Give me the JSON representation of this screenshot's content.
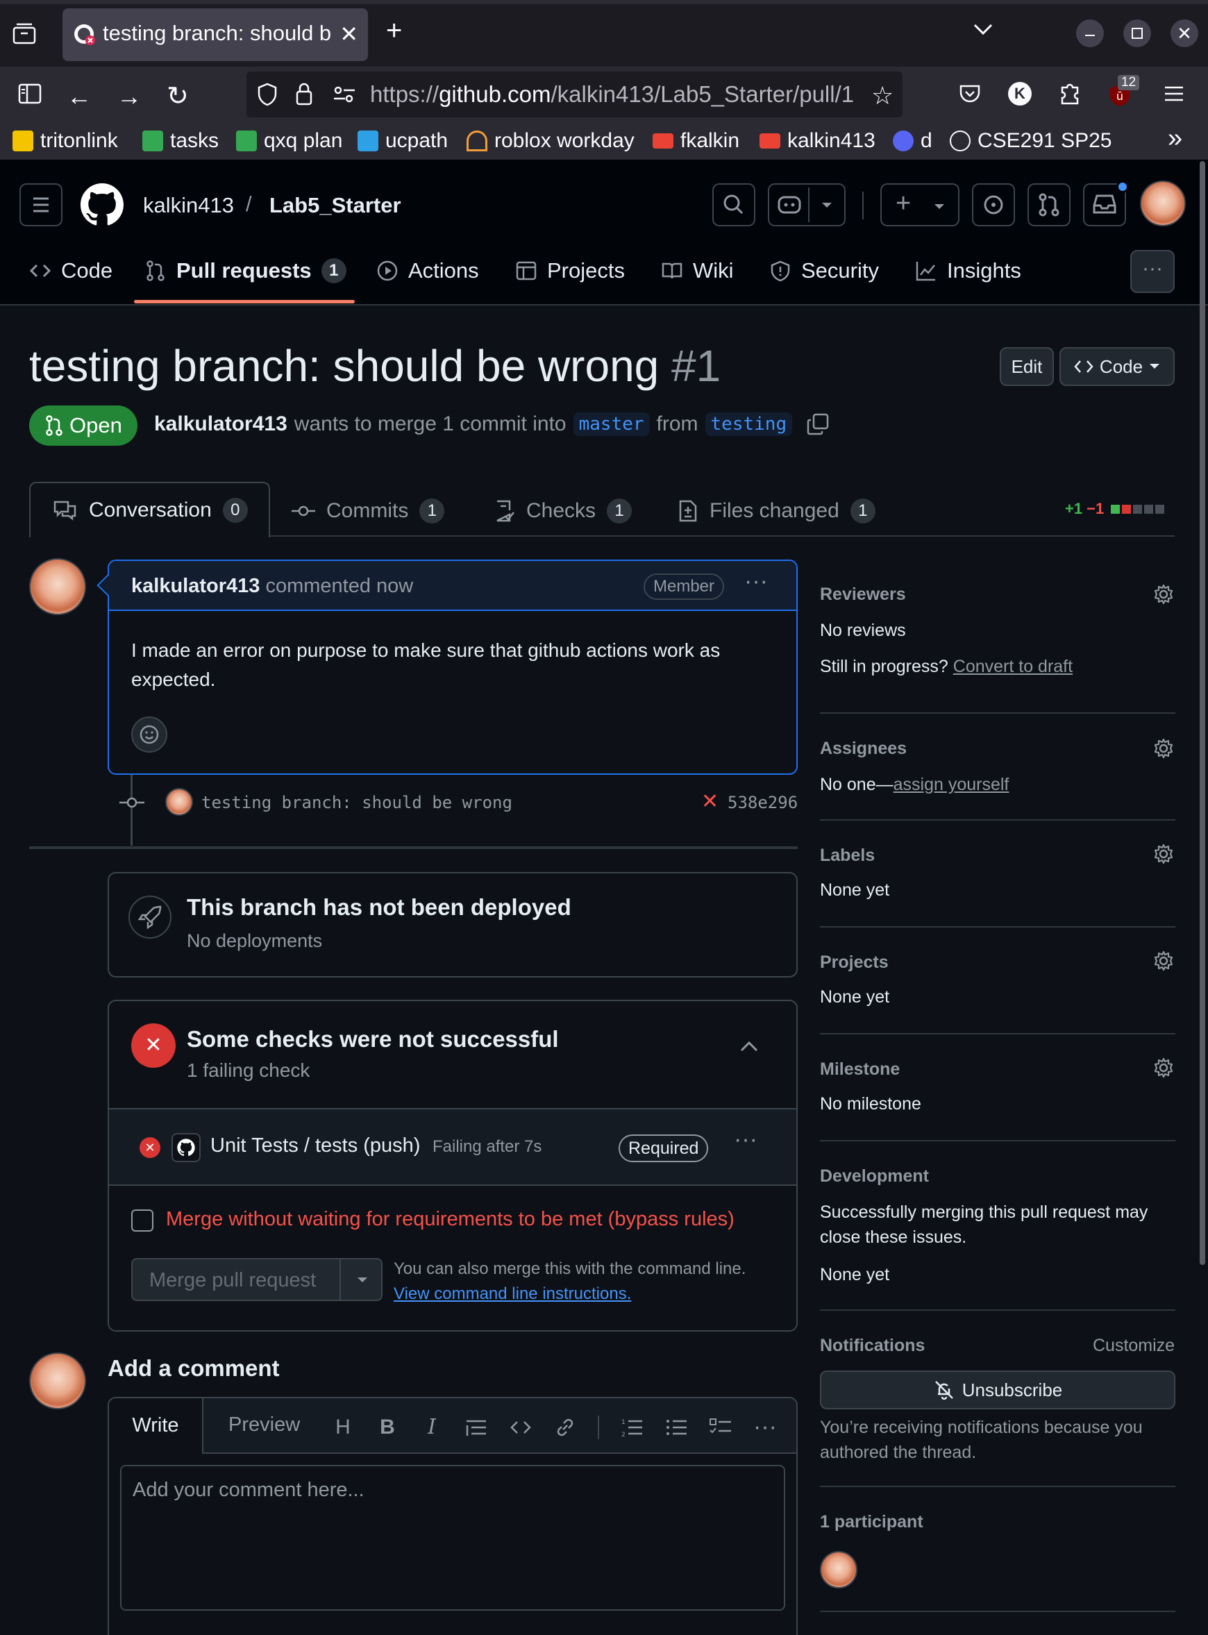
{
  "browser": {
    "tab_title": "testing branch: should be",
    "url_prefix": "https://",
    "url_host": "github.com",
    "url_path": "/kalkin413/Lab5_Starter/pull/1",
    "extension_badge": "12",
    "bookmarks": [
      {
        "label": "tritonlink",
        "color": "#f5c400"
      },
      {
        "label": "tasks",
        "color": "#34a853"
      },
      {
        "label": "qxq plan",
        "color": "#34a853"
      },
      {
        "label": "ucpath",
        "color": "#2ea0e6"
      },
      {
        "label": "roblox workday",
        "color": "#f29d38"
      },
      {
        "label": "fkalkin",
        "color": "#ea4335"
      },
      {
        "label": "kalkin413",
        "color": "#ea4335"
      },
      {
        "label": "d",
        "color": "#5865f2"
      },
      {
        "label": "CSE291 SP25",
        "color": "#cccccc"
      }
    ],
    "overflow_label": "»"
  },
  "header": {
    "owner": "kalkin413",
    "separator": "/",
    "repo": "Lab5_Starter",
    "nav": [
      {
        "label": "Code",
        "icon": "code-icon"
      },
      {
        "label": "Pull requests",
        "icon": "pull-request-icon",
        "count": "1"
      },
      {
        "label": "Actions",
        "icon": "play-icon"
      },
      {
        "label": "Projects",
        "icon": "table-icon"
      },
      {
        "label": "Wiki",
        "icon": "book-icon"
      },
      {
        "label": "Security",
        "icon": "shield-icon"
      },
      {
        "label": "Insights",
        "icon": "graph-icon"
      }
    ],
    "more": "···"
  },
  "pr": {
    "title": "testing branch: should be wrong",
    "number": "#1",
    "edit_label": "Edit",
    "code_label": "Code",
    "state": "Open",
    "author": "kalkulator413",
    "merge_text": "wants to merge 1 commit into",
    "base": "master",
    "from_text": "from",
    "head": "testing",
    "tabs": [
      {
        "label": "Conversation",
        "count": "0"
      },
      {
        "label": "Commits",
        "count": "1"
      },
      {
        "label": "Checks",
        "count": "1"
      },
      {
        "label": "Files changed",
        "count": "1"
      }
    ],
    "diff_add": "+1",
    "diff_del": "−1"
  },
  "comment": {
    "author": "kalkulator413",
    "time": "commented now",
    "role": "Member",
    "menu": "···",
    "body": "I made an error on purpose to make sure that github actions work as expected."
  },
  "commit": {
    "message": "testing branch: should be wrong",
    "sha": "538e296"
  },
  "deploy": {
    "title": "This branch has not been deployed",
    "subtitle": "No deployments"
  },
  "checks": {
    "title": "Some checks were not successful",
    "subtitle": "1 failing check",
    "item_name": "Unit Tests / tests (push)",
    "item_status": "Failing after 7s",
    "required": "Required",
    "menu": "···",
    "bypass": "Merge without waiting for requirements to be met (bypass rules)",
    "merge_button": "Merge pull request",
    "cli_text": "You can also merge this with the command line.",
    "cli_link": "View command line instructions."
  },
  "add_comment": {
    "title": "Add a comment",
    "write_tab": "Write",
    "preview_tab": "Preview",
    "placeholder": "Add your comment here..."
  },
  "sidebar": {
    "reviewers": {
      "heading": "Reviewers",
      "value": "No reviews",
      "progress_prefix": "Still in progress?",
      "progress_link": "Convert to draft"
    },
    "assignees": {
      "heading": "Assignees",
      "value_prefix": "No one—",
      "value_link": "assign yourself"
    },
    "labels": {
      "heading": "Labels",
      "value": "None yet"
    },
    "projects": {
      "heading": "Projects",
      "value": "None yet"
    },
    "milestone": {
      "heading": "Milestone",
      "value": "No milestone"
    },
    "development": {
      "heading": "Development",
      "text": "Successfully merging this pull request may close these issues.",
      "value": "None yet"
    },
    "notifications": {
      "heading": "Notifications",
      "customize": "Customize",
      "button": "Unsubscribe",
      "text": "You’re receiving notifications because you authored the thread."
    },
    "participants": {
      "heading": "1 participant"
    }
  },
  "colors": {
    "accent": "#4493f8",
    "success": "#238636",
    "danger": "#da3633",
    "danger_text": "#f85149",
    "add": "#3fb950"
  }
}
